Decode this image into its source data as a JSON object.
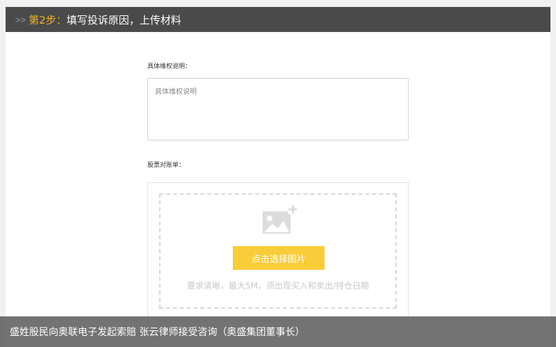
{
  "header": {
    "arrows": ">>",
    "step": "第2步：",
    "title": "填写投诉原因，上传材料"
  },
  "form": {
    "detail_label": "具体维权说明：",
    "detail_placeholder": "具体维权说明",
    "statement_label": "股票对账单：",
    "upload_button": "点击选择图片",
    "upload_requirement": "要求清晰，最大5M，须出现买入和卖出/持仓日期",
    "upload_icon": "add-image-icon"
  },
  "caption": {
    "text": "盛姓股民向奥联电子发起索赔 张云律师接受咨询（奥盛集团董事长）"
  },
  "colors": {
    "header_bg": "#4a4a4a",
    "step_accent": "#f3b229",
    "button_bg": "#f9cc3a"
  }
}
